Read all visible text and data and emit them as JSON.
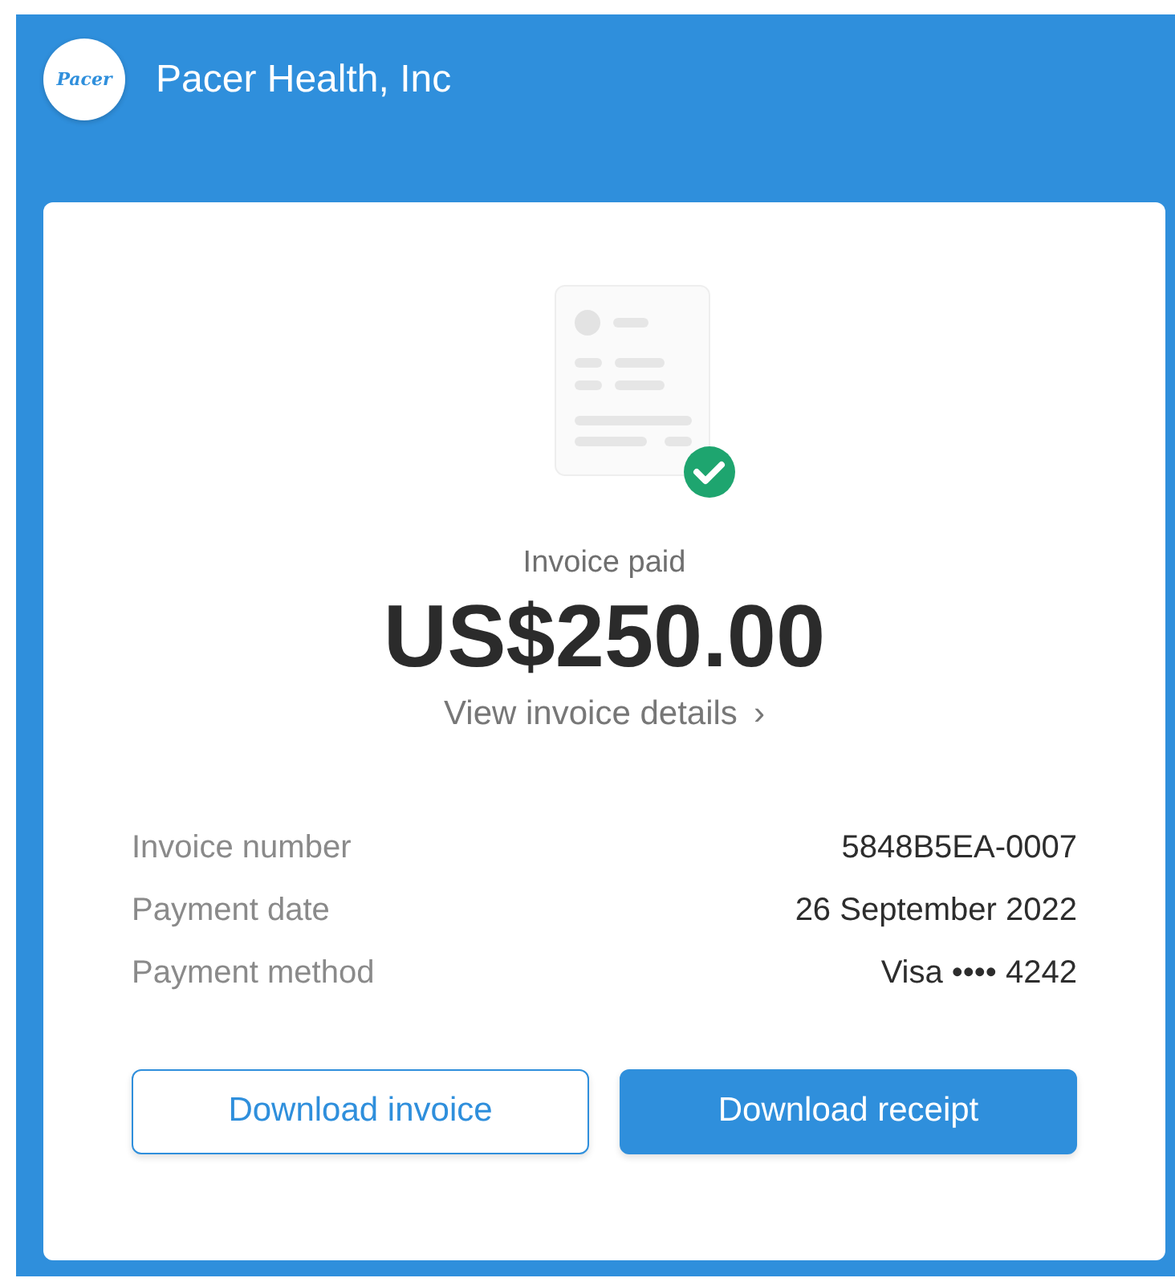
{
  "header": {
    "logo_text": "Pacer",
    "title": "Pacer Health, Inc"
  },
  "status": {
    "label": "Invoice paid",
    "amount": "US$250.00",
    "link": "View invoice details",
    "link_icon": "›"
  },
  "details": [
    {
      "label": "Invoice number",
      "value": "5848B5EA-0007"
    },
    {
      "label": "Payment date",
      "value": "26 September 2022"
    },
    {
      "label": "Payment method",
      "value": "Visa •••• 4242"
    }
  ],
  "buttons": [
    {
      "label": "Download invoice",
      "kind": "secondary"
    },
    {
      "label": "Download receipt",
      "kind": "primary"
    }
  ]
}
